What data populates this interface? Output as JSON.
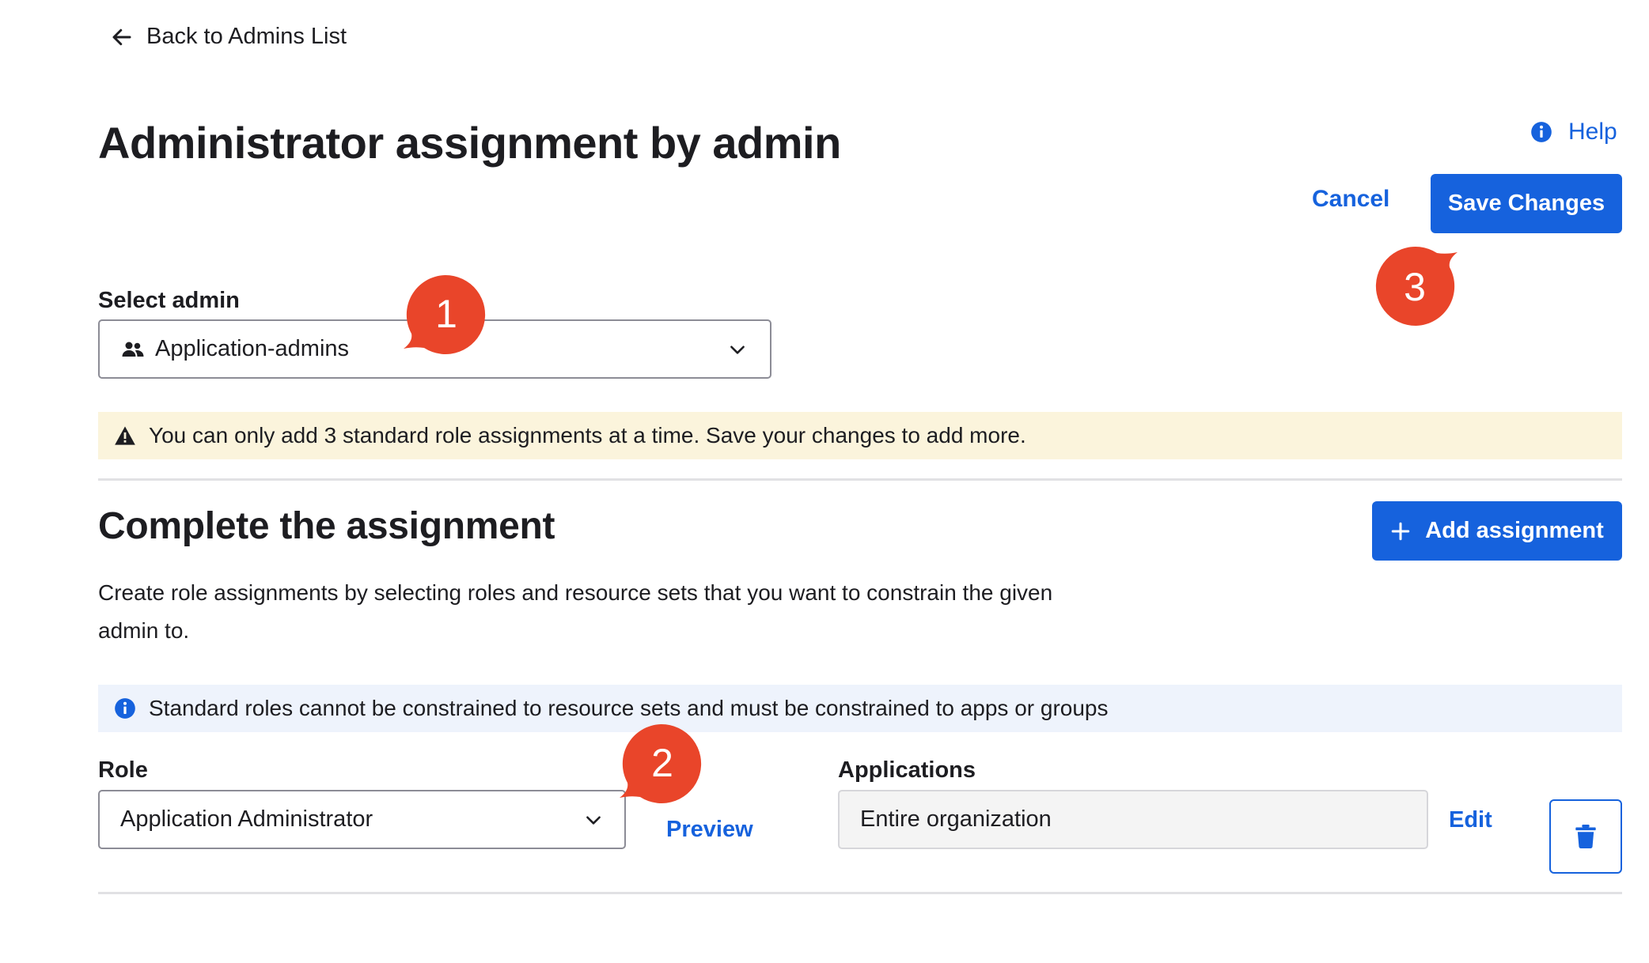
{
  "back_link": {
    "label": "Back to Admins List",
    "icon": "arrow-left-icon"
  },
  "page": {
    "title": "Administrator assignment by admin"
  },
  "help": {
    "label": "Help",
    "icon": "info-circle-icon"
  },
  "actions": {
    "cancel_label": "Cancel",
    "save_label": "Save Changes"
  },
  "select_admin": {
    "label": "Select admin",
    "value": "Application-admins",
    "icon": "group-icon"
  },
  "warning": {
    "text": "You can only add 3 standard role assignments at a time. Save your changes to add more.",
    "icon": "warning-triangle-icon"
  },
  "assignment": {
    "title": "Complete the assignment",
    "add_label": "Add assignment",
    "description": "Create role assignments by selecting roles and resource sets that you want to constrain the given admin to.",
    "info": "Standard roles cannot be constrained to resource sets and must be constrained to apps or groups",
    "role_label": "Role",
    "role_value": "Application Administrator",
    "preview_label": "Preview",
    "applications_label": "Applications",
    "applications_value": "Entire organization",
    "edit_label": "Edit"
  },
  "callouts": [
    "1",
    "2",
    "3"
  ],
  "colors": {
    "accent": "#1662dd",
    "callout": "#e9452a",
    "warning_bg": "#fbf4dc",
    "info_bg": "#eef3fc"
  }
}
